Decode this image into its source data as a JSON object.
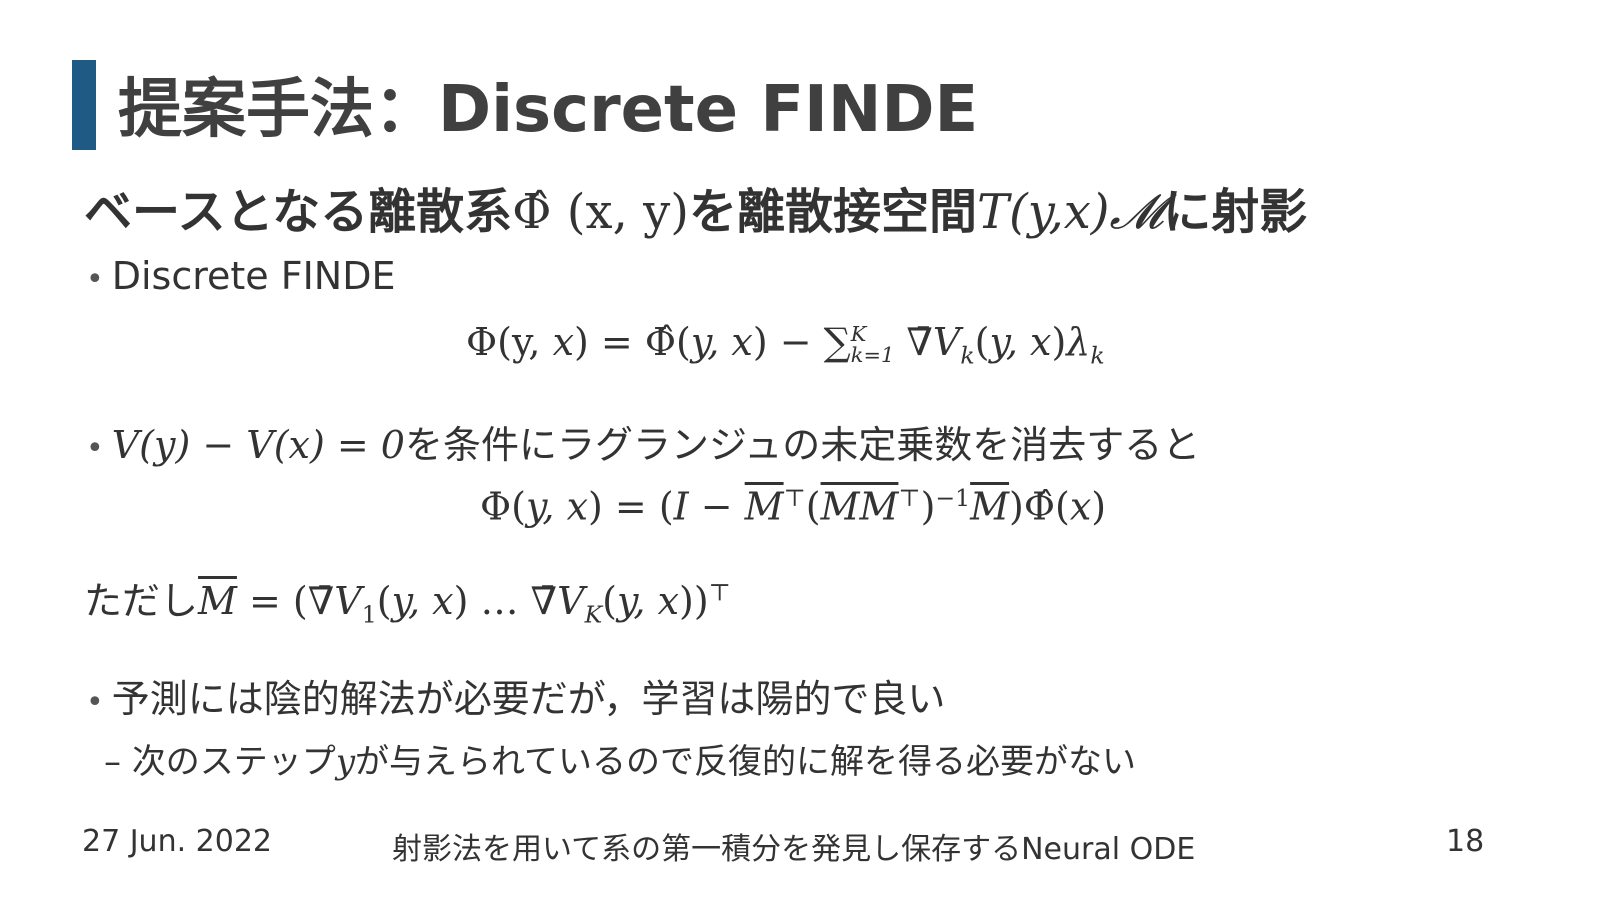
{
  "slide": {
    "title": "提案手法：Discrete FINDE",
    "subtitle": {
      "text1": "ベースとなる離散系",
      "math1": "Φ̂ (x, y)",
      "text2": "を離散接空間",
      "math2": "T(y,x)𝓜",
      "text3": "に射影"
    },
    "bullets": [
      {
        "text": "Discrete FINDE"
      },
      {
        "math": "V(y) − V(x) = 0",
        "text": "を条件にラグランジュの未定乗数を消去すると"
      },
      {
        "text": "予測には陰的解法が必要だが，学習は陽的で良い"
      }
    ],
    "sub_bullet": {
      "text1": "次のステップ",
      "math": "y",
      "text2": "が与えられているので反復的に解を得る必要がない"
    },
    "equations": {
      "eq1": "Φ(y, x) = Φ̂(y, x) − ∑_{k=1}^{K} ∇̄V_k(y, x)λ_k",
      "eq2": "Φ(y, x) = (I − M̄^⊤(M̄M̄^⊤)^{−1}M̄)Φ̂(x)",
      "where_label": "ただし",
      "eq3": "M̄ = (∇̄V_1(y, x) … ∇̄V_K(y, x))^⊤"
    }
  },
  "footer": {
    "date": "27 Jun. 2022",
    "center": "射影法を用いて系の第一積分を発見し保存するNeural ODE",
    "page": "18"
  },
  "colors": {
    "accent": "#1f5a85",
    "title": "#404040",
    "text": "#333333"
  }
}
